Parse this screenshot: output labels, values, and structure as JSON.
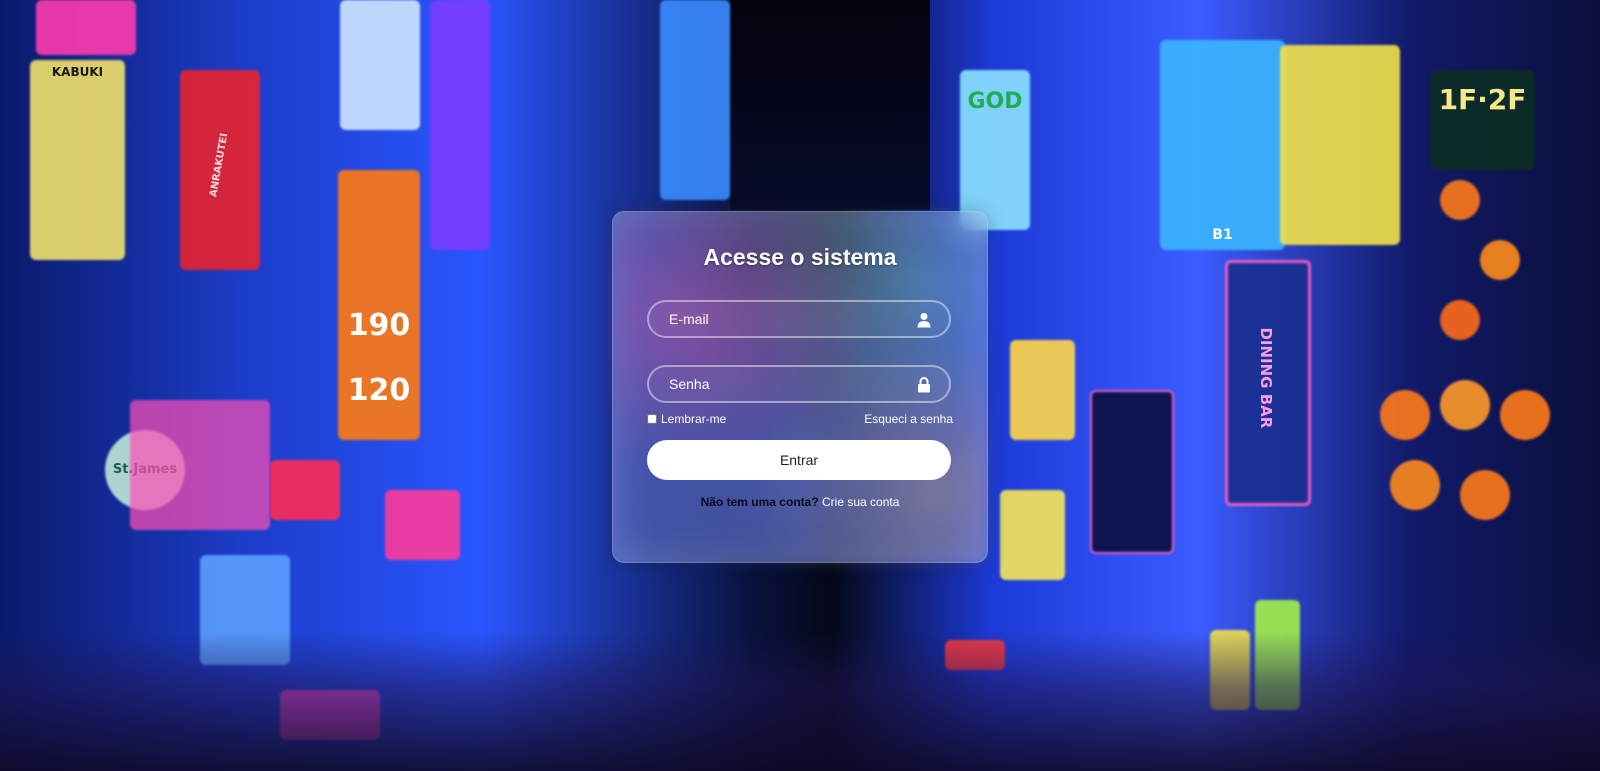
{
  "background": {
    "signs": [
      {
        "text": "KABUKI"
      },
      {
        "text": "ANRAKUTEI"
      },
      {
        "text": "190"
      },
      {
        "text": "120"
      },
      {
        "text": "St.James"
      },
      {
        "text": "1F·2F"
      },
      {
        "text": "DINING BAR"
      },
      {
        "text": "GOD"
      },
      {
        "text": "B1"
      }
    ]
  },
  "login": {
    "title": "Acesse o sistema",
    "email_placeholder": "E-mail",
    "password_placeholder": "Senha",
    "remember_label": "Lembrar-me",
    "forgot_label": "Esqueci a senha",
    "submit_label": "Entrar",
    "register_question": "Não tem uma conta?",
    "register_link": "Crie sua conta"
  },
  "icons": {
    "email_field_icon": "user-icon",
    "password_field_icon": "lock-icon"
  },
  "colors": {
    "card_bg": "#96a0e6",
    "button_bg": "#ffffff",
    "text": "#ffffff"
  }
}
